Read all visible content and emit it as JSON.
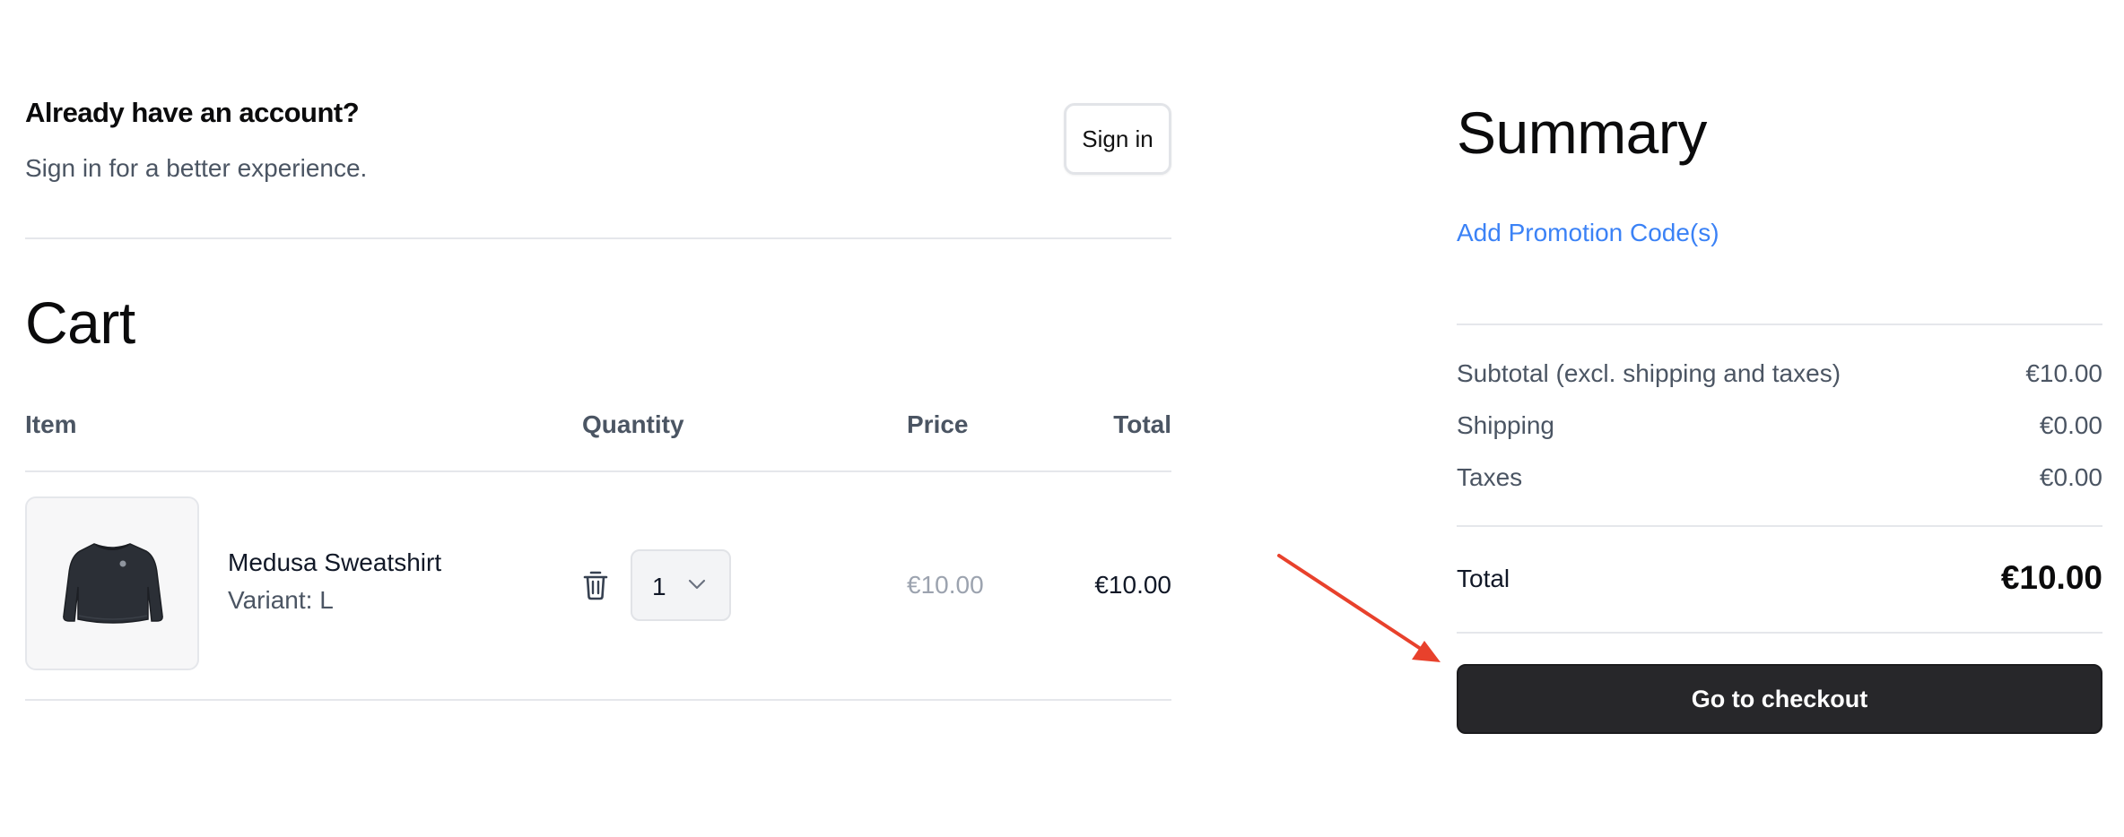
{
  "account": {
    "title": "Already have an account?",
    "subtitle": "Sign in for a better experience.",
    "sign_in_label": "Sign in"
  },
  "cart": {
    "title": "Cart",
    "columns": {
      "item": "Item",
      "quantity": "Quantity",
      "price": "Price",
      "total": "Total"
    },
    "items": [
      {
        "name": "Medusa Sweatshirt",
        "variant": "Variant: L",
        "quantity": "1",
        "price": "€10.00",
        "total": "€10.00",
        "thumbnail_icon": "sweatshirt-icon",
        "delete_icon": "trash-icon"
      }
    ]
  },
  "summary": {
    "title": "Summary",
    "promo_link": "Add Promotion Code(s)",
    "rows": [
      {
        "label": "Subtotal (excl. shipping and taxes)",
        "value": "€10.00"
      },
      {
        "label": "Shipping",
        "value": "€0.00"
      },
      {
        "label": "Taxes",
        "value": "€0.00"
      }
    ],
    "total_label": "Total",
    "total_value": "€10.00",
    "checkout_label": "Go to checkout"
  },
  "annotation": {
    "arrow_icon": "red-arrow-icon",
    "arrow_color": "#e8412c"
  },
  "colors": {
    "link": "#3b82f6",
    "checkout_button": "#27272a",
    "muted_price": "#9ca3af"
  }
}
